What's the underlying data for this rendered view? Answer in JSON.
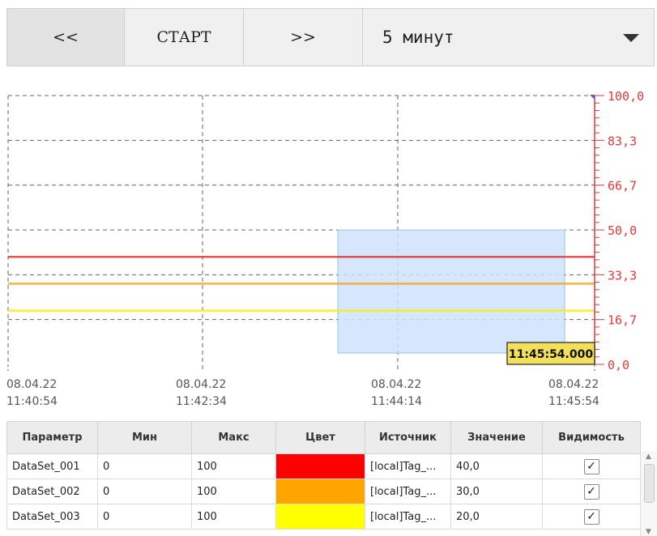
{
  "toolbar": {
    "prev_label": "<<",
    "start_label": "СТАРТ",
    "next_label": ">>",
    "period_value": "5 минут"
  },
  "chart_data": {
    "type": "line",
    "x_ticks": [
      {
        "date": "08.04.22",
        "time": "11:40:54"
      },
      {
        "date": "08.04.22",
        "time": "11:42:34"
      },
      {
        "date": "08.04.22",
        "time": "11:44:14"
      },
      {
        "date": "08.04.22",
        "time": "11:45:54"
      }
    ],
    "y_ticks": [
      "100,0",
      "83,3",
      "66,7",
      "50,0",
      "33,3",
      "16,7",
      "0,0"
    ],
    "ylim": [
      0,
      100
    ],
    "grid": true,
    "series": [
      {
        "name": "DataSet_001",
        "values": [
          40,
          40
        ],
        "color": "#e23636"
      },
      {
        "name": "DataSet_002",
        "values": [
          30,
          30
        ],
        "color": "#f5a623"
      },
      {
        "name": "DataSet_003",
        "values": [
          20,
          20
        ],
        "color": "#f7f000"
      }
    ],
    "selection": {
      "x_from": "11:44:14",
      "x_to": "11:45:54",
      "y_from": 0,
      "y_to": 50,
      "color": "#cfe2fb"
    },
    "cursor_label": "11:45:54.000",
    "axis_color": "#e23a3a"
  },
  "table": {
    "columns": [
      "Параметр",
      "Мин",
      "Макс",
      "Цвет",
      "Источник",
      "Значение",
      "Видимость"
    ],
    "rows": [
      {
        "param": "DataSet_001",
        "min": "0",
        "max": "100",
        "color": "#ff0000",
        "source": "[local]Tag_...",
        "value": "40,0",
        "visible": "✓"
      },
      {
        "param": "DataSet_002",
        "min": "0",
        "max": "100",
        "color": "#ffa500",
        "source": "[local]Tag_...",
        "value": "30,0",
        "visible": "✓"
      },
      {
        "param": "DataSet_003",
        "min": "0",
        "max": "100",
        "color": "#ffff00",
        "source": "[local]Tag_...",
        "value": "20,0",
        "visible": "✓"
      }
    ]
  }
}
